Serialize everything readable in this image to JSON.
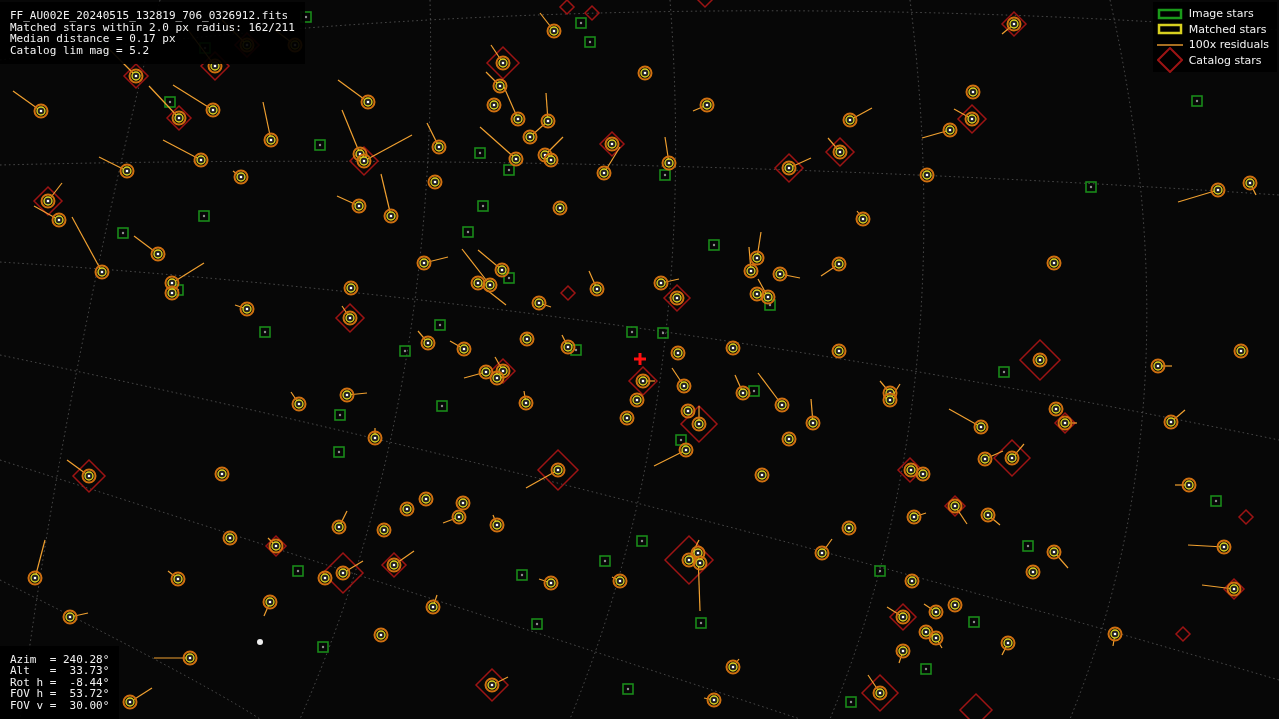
{
  "file_info": {
    "lines": [
      "FF_AU002E_20240515_132819_706_0326912.fits",
      "Matched stars within 2.0 px radius: 162/211",
      "Median distance = 0.17 px",
      "Catalog lim mag = 5.2"
    ]
  },
  "legend": [
    {
      "kind": "image",
      "label": "Image stars"
    },
    {
      "kind": "matched",
      "label": "Matched stars"
    },
    {
      "kind": "residual",
      "label": "100x residuals"
    },
    {
      "kind": "catalog",
      "label": "Catalog stars"
    }
  ],
  "pointing": {
    "lines": [
      "Azim  = 240.28°",
      "Alt   =  33.73°",
      "Rot h =  -8.44°",
      "FOV h =  53.72°",
      "FOV v =  30.00°"
    ]
  }
}
